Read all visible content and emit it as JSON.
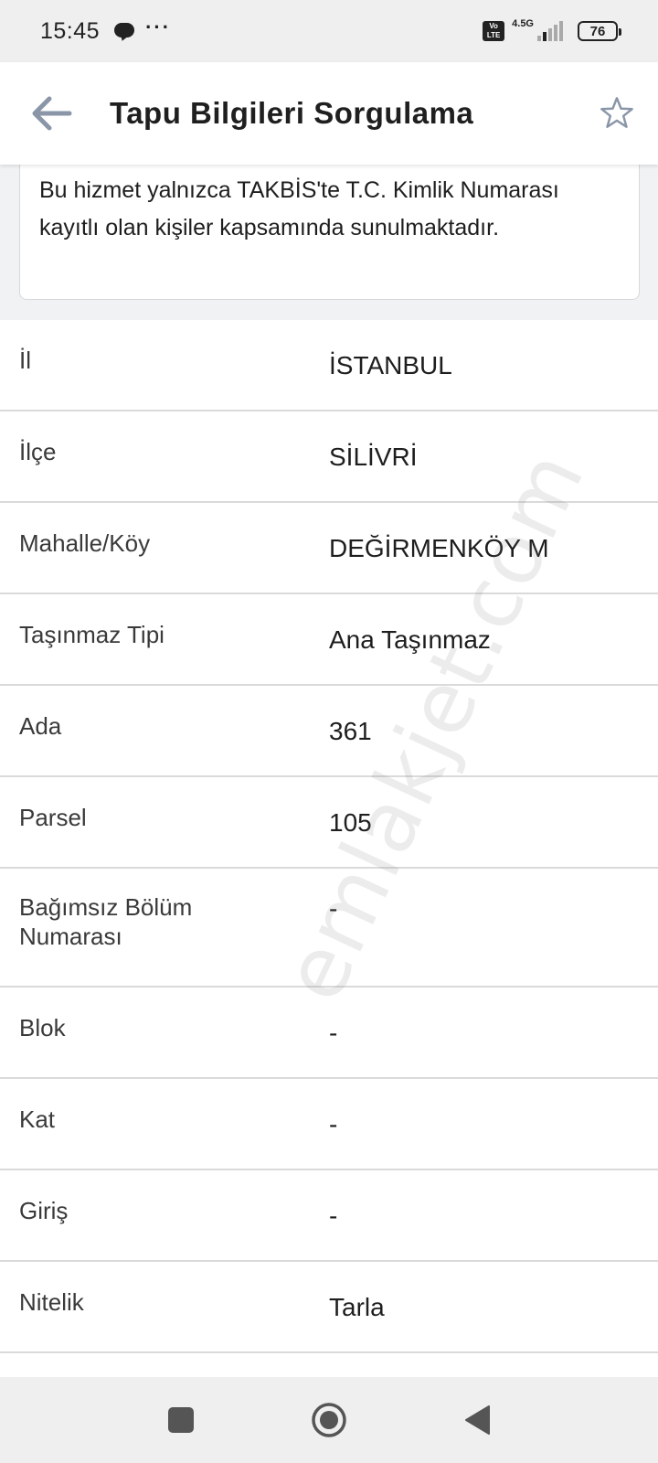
{
  "status_bar": {
    "time": "15:45",
    "dots": "···",
    "network_type": "4.5G",
    "volte": "Vo LTE",
    "battery": "76"
  },
  "app_bar": {
    "title": "Tapu Bilgileri Sorgulama",
    "back_icon": "arrow-left-icon",
    "favorite_icon": "star-outline-icon"
  },
  "notice": {
    "text": "Bu hizmet yalnızca TAKBİS'te T.C. Kimlik Numarası kayıtlı olan kişiler kapsamında sunulmaktadır."
  },
  "details": [
    {
      "label": "İl",
      "value": "İSTANBUL"
    },
    {
      "label": "İlçe",
      "value": "SİLİVRİ"
    },
    {
      "label": "Mahalle/Köy",
      "value": "DEĞİRMENKÖY M"
    },
    {
      "label": "Taşınmaz Tipi",
      "value": "Ana Taşınmaz"
    },
    {
      "label": "Ada",
      "value": "361"
    },
    {
      "label": "Parsel",
      "value": "105"
    },
    {
      "label": "Bağımsız Bölüm Numarası",
      "value": "-"
    },
    {
      "label": "Blok",
      "value": "-"
    },
    {
      "label": "Kat",
      "value": "-"
    },
    {
      "label": "Giriş",
      "value": "-"
    },
    {
      "label": "Nitelik",
      "value": "Tarla"
    }
  ],
  "watermark": "emlakjet.com",
  "nav_bar": {
    "recent_icon": "square-icon",
    "home_icon": "circle-home-icon",
    "back_icon": "triangle-back-icon"
  },
  "colors": {
    "status_bg": "#efefef",
    "info_bg": "#f1f2f4",
    "divider": "#dadada",
    "icon_gray": "#8a96a8"
  }
}
